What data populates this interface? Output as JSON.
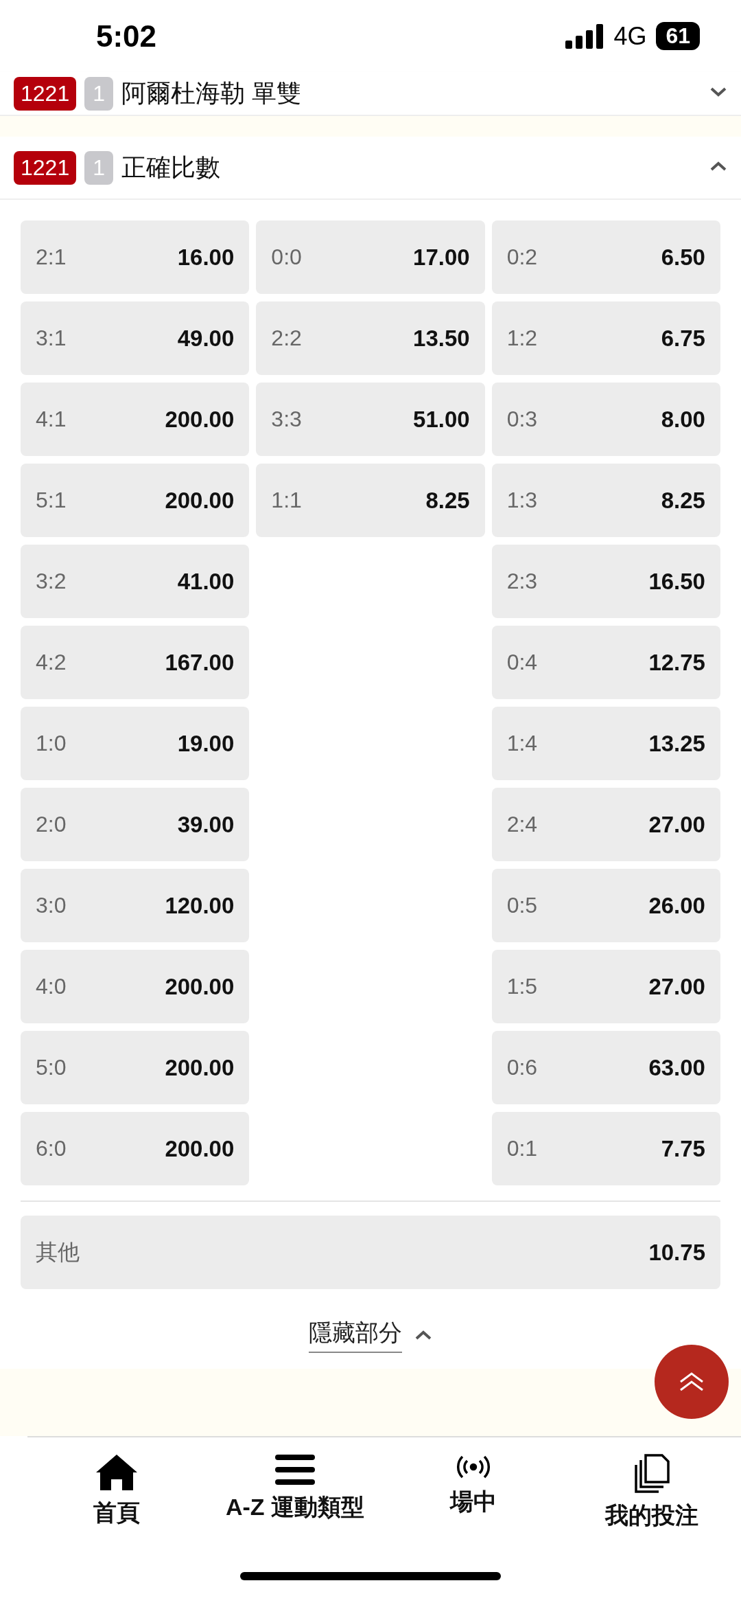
{
  "status_bar": {
    "time": "5:02",
    "network": "4G",
    "battery": "61"
  },
  "collapsed_market": {
    "match_code": "1221",
    "index": "1",
    "title": "阿爾杜海勒 單雙",
    "expanded": false
  },
  "market": {
    "match_code": "1221",
    "index": "1",
    "title": "正確比數",
    "expanded": true,
    "columns": [
      [
        {
          "score": "2:1",
          "odds": "16.00"
        },
        {
          "score": "3:1",
          "odds": "49.00"
        },
        {
          "score": "4:1",
          "odds": "200.00"
        },
        {
          "score": "5:1",
          "odds": "200.00"
        },
        {
          "score": "3:2",
          "odds": "41.00"
        },
        {
          "score": "4:2",
          "odds": "167.00"
        },
        {
          "score": "1:0",
          "odds": "19.00"
        },
        {
          "score": "2:0",
          "odds": "39.00"
        },
        {
          "score": "3:0",
          "odds": "120.00"
        },
        {
          "score": "4:0",
          "odds": "200.00"
        },
        {
          "score": "5:0",
          "odds": "200.00"
        },
        {
          "score": "6:0",
          "odds": "200.00"
        }
      ],
      [
        {
          "score": "0:0",
          "odds": "17.00"
        },
        {
          "score": "2:2",
          "odds": "13.50"
        },
        {
          "score": "3:3",
          "odds": "51.00"
        },
        {
          "score": "1:1",
          "odds": "8.25"
        }
      ],
      [
        {
          "score": "0:2",
          "odds": "6.50"
        },
        {
          "score": "1:2",
          "odds": "6.75"
        },
        {
          "score": "0:3",
          "odds": "8.00"
        },
        {
          "score": "1:3",
          "odds": "8.25"
        },
        {
          "score": "2:3",
          "odds": "16.50"
        },
        {
          "score": "0:4",
          "odds": "12.75"
        },
        {
          "score": "1:4",
          "odds": "13.25"
        },
        {
          "score": "2:4",
          "odds": "27.00"
        },
        {
          "score": "0:5",
          "odds": "26.00"
        },
        {
          "score": "1:5",
          "odds": "27.00"
        },
        {
          "score": "0:6",
          "odds": "63.00"
        },
        {
          "score": "0:1",
          "odds": "7.75"
        }
      ]
    ],
    "other": {
      "label": "其他",
      "odds": "10.75"
    },
    "toggle": "隱藏部分"
  },
  "bottom_nav": [
    {
      "label": "首頁"
    },
    {
      "label": "A-Z 運動類型"
    },
    {
      "label": "場中"
    },
    {
      "label": "我的投注"
    }
  ]
}
